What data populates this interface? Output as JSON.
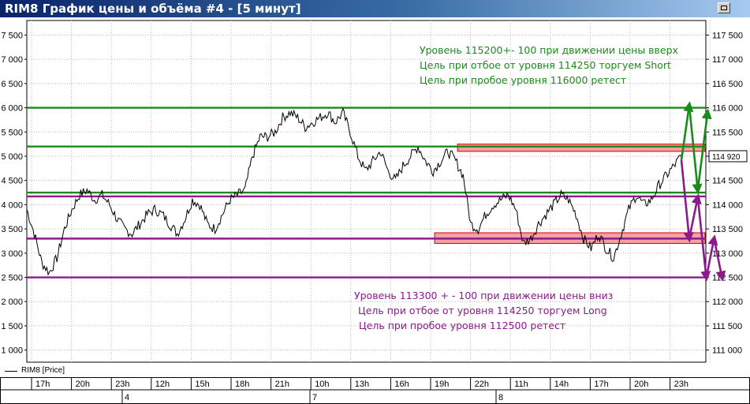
{
  "window": {
    "title": "RIM8 График цены и объёма #4 - [5 минут]"
  },
  "legend": {
    "series_label": "RIM8 [Price]"
  },
  "colors": {
    "green": "#1a8a1a",
    "purple": "#8b1a8b",
    "red_zone": "#f4a0a0",
    "red_border": "#d40000"
  },
  "chart_data": {
    "type": "line",
    "y_ticks_left": [
      "7 500",
      "7 000",
      "6 500",
      "6 000",
      "5 500",
      "5 000",
      "4 500",
      "4 000",
      "3 500",
      "3 000",
      "2 500",
      "2 000",
      "1 500",
      "1 000"
    ],
    "y_ticks_right": [
      "117 500",
      "117 000",
      "116 500",
      "116 000",
      "115 500",
      "115 000",
      "114 500",
      "114 000",
      "113 500",
      "113 000",
      "112 500",
      "112 000",
      "111 500",
      "111 000"
    ],
    "ylim": [
      110750,
      117800
    ],
    "last_price_label": "114 920",
    "time_labels": [
      "17h",
      "20h",
      "23h",
      "12h",
      "15h",
      "18h",
      "21h",
      "10h",
      "13h",
      "16h",
      "19h",
      "22h",
      "11h",
      "14h",
      "17h",
      "20h",
      "23h"
    ],
    "day_labels": [
      "4",
      "7",
      "8"
    ],
    "levels": [
      {
        "value": 116000,
        "color": "green"
      },
      {
        "value": 115200,
        "color": "green"
      },
      {
        "value": 114250,
        "color": "green"
      },
      {
        "value": 114170,
        "color": "purple"
      },
      {
        "value": 113300,
        "color": "purple"
      },
      {
        "value": 112500,
        "color": "purple"
      }
    ],
    "zones": [
      {
        "from": 115100,
        "to": 115250,
        "start_frac": 0.658
      },
      {
        "from": 113200,
        "to": 113420,
        "start_frac": 0.623
      }
    ],
    "price": [
      113900,
      113400,
      112800,
      112600,
      112900,
      113500,
      113900,
      114200,
      114300,
      114100,
      114200,
      114000,
      113700,
      113500,
      113400,
      113600,
      113800,
      113900,
      113800,
      113600,
      113400,
      113700,
      114100,
      114000,
      113600,
      113500,
      113800,
      114100,
      114200,
      114300,
      115000,
      115400,
      115400,
      115500,
      115800,
      115900,
      115800,
      115600,
      115700,
      115800,
      115900,
      115700,
      115900,
      115500,
      115000,
      114700,
      114900,
      115100,
      114700,
      114500,
      114800,
      115000,
      115200,
      114900,
      114700,
      114900,
      115100,
      114900,
      114600,
      113600,
      113500,
      113800,
      114000,
      114100,
      114200,
      113900,
      113200,
      113300,
      113600,
      113800,
      114000,
      114200,
      114100,
      113800,
      113300,
      113100,
      113400,
      113100,
      112900,
      113400,
      113900,
      114200,
      114000,
      114100,
      114400,
      114600,
      114800,
      115000
    ],
    "annotations_top": [
      "Уровень 115200+- 100 при движении цены вверх",
      "Цель при отбое от уровня 114250 торгуем Short",
      "Цель при пробое уровня 116000 ретест"
    ],
    "annotations_bottom": [
      "Уровень 113300 + - 100  при движении цены вниз",
      "Цель при отбое от уровня 114250 торгуем Long",
      "Цель при пробое уровня 112500 ретест"
    ],
    "arrows": [
      {
        "color": "green",
        "path": [
          [
            1.0,
            114920
          ],
          [
            1.012,
            116050
          ],
          [
            1.025,
            114300
          ],
          [
            1.04,
            115900
          ]
        ]
      },
      {
        "color": "purple",
        "path": [
          [
            1.0,
            114920
          ],
          [
            1.012,
            113300
          ],
          [
            1.025,
            114150
          ],
          [
            1.038,
            112500
          ],
          [
            1.05,
            113300
          ],
          [
            1.062,
            112500
          ]
        ]
      }
    ]
  }
}
